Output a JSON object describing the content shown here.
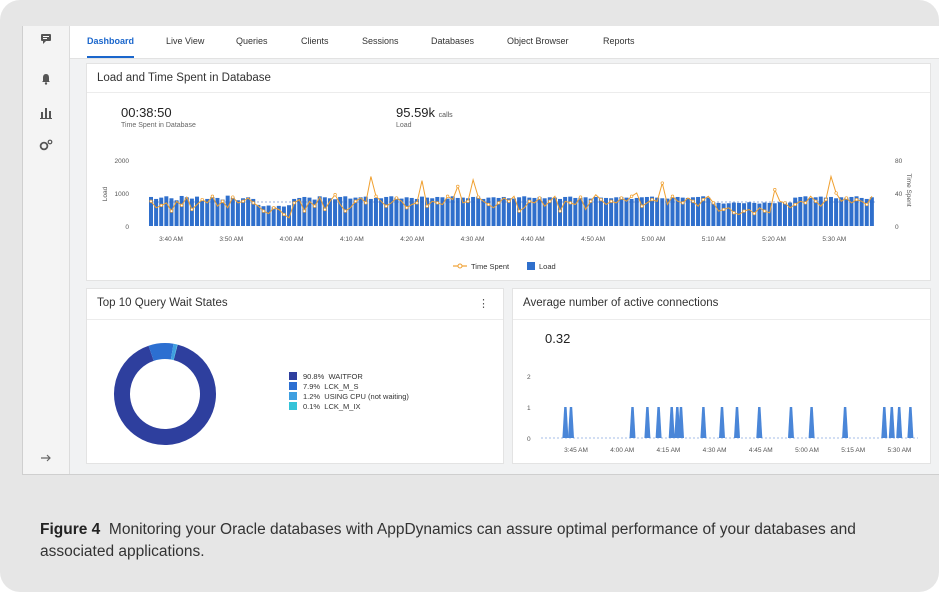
{
  "nav": {
    "tabs": [
      "Dashboard",
      "Live View",
      "Queries",
      "Clients",
      "Sessions",
      "Databases",
      "Object Browser",
      "Reports"
    ],
    "active": 0
  },
  "load_card": {
    "title": "Load and Time Spent in Database",
    "time_spent_value": "00:38:50",
    "time_spent_label": "Time Spent in Database",
    "load_value": "95.59k",
    "load_unit": "calls",
    "load_label": "Load",
    "y_left_label": "Load",
    "y_right_label": "Time Spent",
    "y_left_ticks": [
      "2000",
      "1000",
      "0"
    ],
    "y_right_ticks": [
      "80",
      "40",
      "0"
    ],
    "x_ticks": [
      "3:40 AM",
      "3:50 AM",
      "4:00 AM",
      "4:10 AM",
      "4:20 AM",
      "4:30 AM",
      "4:40 AM",
      "4:50 AM",
      "5:00 AM",
      "5:10 AM",
      "5:20 AM",
      "5:30 AM"
    ],
    "legend_time_spent": "Time Spent",
    "legend_load": "Load"
  },
  "wait_card": {
    "title": "Top 10 Query Wait States",
    "items": [
      {
        "pct": "90.8%",
        "label": "WAITFOR",
        "value": 90.8,
        "color": "#2e3f9e"
      },
      {
        "pct": "7.9%",
        "label": "LCK_M_S",
        "value": 7.9,
        "color": "#2c6fd1"
      },
      {
        "pct": "1.2%",
        "label": "USING CPU (not waiting)",
        "value": 1.2,
        "color": "#3f9fe0"
      },
      {
        "pct": "0.1%",
        "label": "LCK_M_IX",
        "value": 0.1,
        "color": "#35c3d8"
      }
    ]
  },
  "conn_card": {
    "title": "Average number of active connections",
    "value": "0.32",
    "y_ticks": [
      "2",
      "1",
      "0"
    ],
    "x_ticks": [
      "3:45 AM",
      "4:00 AM",
      "4:15 AM",
      "4:30 AM",
      "4:45 AM",
      "5:00 AM",
      "5:15 AM",
      "5:30 AM"
    ]
  },
  "caption": {
    "label": "Figure 4",
    "text": "Monitoring your Oracle databases with AppDynamics can assure optimal performance of your databases and associated applications."
  },
  "chart_data": [
    {
      "type": "bar",
      "x_start": "3:36 AM",
      "x_end": "5:36 AM",
      "ylim_left": [
        0,
        2000
      ],
      "ylim_right": [
        0,
        80
      ],
      "series": [
        {
          "name": "Load",
          "values": [
            880,
            820,
            860,
            900,
            840,
            780,
            910,
            870,
            830,
            890,
            760,
            820,
            880,
            850,
            800,
            920,
            860,
            780,
            840,
            870,
            820,
            640,
            600,
            620,
            580,
            610,
            590,
            630,
            820,
            850,
            880,
            860,
            800,
            900,
            870,
            840,
            810,
            880,
            900,
            830,
            860,
            870,
            890,
            820,
            850,
            840,
            880,
            900,
            860,
            830,
            870,
            850,
            820,
            890,
            860,
            840,
            880,
            870,
            830,
            900,
            850,
            860,
            840,
            880,
            890,
            820,
            860,
            870,
            850,
            880,
            840,
            830,
            870,
            900,
            860,
            850,
            880,
            840,
            870,
            860,
            820,
            880,
            890,
            850,
            860,
            870,
            830,
            880,
            860,
            850,
            840,
            870,
            880,
            860,
            820,
            850,
            870,
            880,
            890,
            860,
            840,
            830,
            870,
            880,
            860,
            850,
            870,
            880,
            900,
            860,
            720,
            700,
            680,
            690,
            710,
            700,
            690,
            720,
            700,
            680,
            710,
            700,
            690,
            720,
            700,
            710,
            860,
            880,
            900,
            850,
            870,
            890,
            860,
            880,
            840,
            870,
            860,
            880,
            900,
            850,
            820,
            870
          ]
        },
        {
          "name": "Time Spent",
          "values": [
            30,
            22,
            25,
            28,
            18,
            30,
            25,
            35,
            20,
            26,
            32,
            28,
            36,
            24,
            30,
            22,
            35,
            28,
            30,
            34,
            28,
            24,
            18,
            15,
            22,
            20,
            14,
            10,
            28,
            32,
            18,
            30,
            24,
            35,
            20,
            30,
            38,
            26,
            18,
            22,
            30,
            34,
            28,
            60,
            36,
            30,
            24,
            28,
            34,
            30,
            22,
            26,
            28,
            55,
            24,
            30,
            28,
            26,
            36,
            32,
            48,
            28,
            30,
            56,
            35,
            30,
            26,
            22,
            28,
            34,
            30,
            36,
            18,
            22,
            30,
            28,
            34,
            24,
            30,
            36,
            18,
            30,
            28,
            26,
            35,
            20,
            30,
            38,
            32,
            26,
            30,
            28,
            34,
            30,
            36,
            40,
            24,
            28,
            32,
            30,
            52,
            26,
            36,
            30,
            28,
            34,
            30,
            24,
            32,
            36,
            28,
            18,
            20,
            22,
            16,
            14,
            18,
            20,
            15,
            22,
            18,
            16,
            44,
            30,
            28,
            22,
            26,
            30,
            28,
            36,
            30,
            24,
            32,
            60,
            40,
            30,
            34,
            28,
            32,
            30,
            26,
            36
          ]
        }
      ]
    },
    {
      "type": "pie",
      "categories": [
        "WAITFOR",
        "LCK_M_S",
        "USING CPU (not waiting)",
        "LCK_M_IX"
      ],
      "values": [
        90.8,
        7.9,
        1.2,
        0.1
      ]
    },
    {
      "type": "area",
      "x_start": "3:39 AM",
      "x_end": "5:36 AM",
      "ylim": [
        0,
        2
      ],
      "peaks": [
        {
          "t": 0.06,
          "v": 1.0
        },
        {
          "t": 0.075,
          "v": 1.0
        },
        {
          "t": 0.24,
          "v": 1.0
        },
        {
          "t": 0.28,
          "v": 1.0
        },
        {
          "t": 0.31,
          "v": 1.0
        },
        {
          "t": 0.345,
          "v": 1.0
        },
        {
          "t": 0.36,
          "v": 1.0
        },
        {
          "t": 0.37,
          "v": 1.0
        },
        {
          "t": 0.43,
          "v": 1.0
        },
        {
          "t": 0.48,
          "v": 1.0
        },
        {
          "t": 0.52,
          "v": 1.0
        },
        {
          "t": 0.58,
          "v": 1.0
        },
        {
          "t": 0.665,
          "v": 1.0
        },
        {
          "t": 0.72,
          "v": 1.0
        },
        {
          "t": 0.81,
          "v": 1.0
        },
        {
          "t": 0.915,
          "v": 1.0
        },
        {
          "t": 0.935,
          "v": 1.0
        },
        {
          "t": 0.955,
          "v": 1.0
        },
        {
          "t": 0.985,
          "v": 1.0
        }
      ]
    }
  ]
}
